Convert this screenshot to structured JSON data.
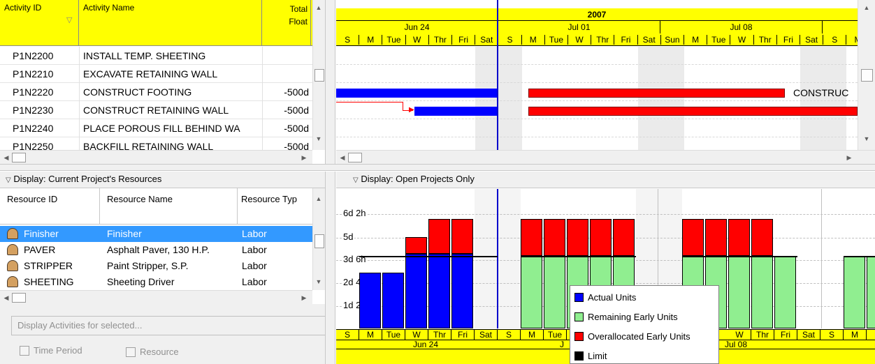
{
  "activity_table": {
    "headers": {
      "id": "Activity ID",
      "name": "Activity Name",
      "float_line1": "Total",
      "float_line2": "Float"
    },
    "rows": [
      {
        "id": "P1N2200",
        "name": "INSTALL TEMP. SHEETING",
        "float": ""
      },
      {
        "id": "P1N2210",
        "name": "EXCAVATE RETAINING WALL",
        "float": ""
      },
      {
        "id": "P1N2220",
        "name": "CONSTRUCT FOOTING",
        "float": "-500d"
      },
      {
        "id": "P1N2230",
        "name": "CONSTRUCT RETAINING WALL",
        "float": "-500d"
      },
      {
        "id": "P1N2240",
        "name": "PLACE POROUS FILL BEHIND WA",
        "float": "-500d"
      },
      {
        "id": "P1N2250",
        "name": "BACKFILL RETAINING WALL",
        "float": "-500d"
      }
    ]
  },
  "gantt": {
    "year": "2007",
    "weeks": [
      "Jun 24",
      "Jul 01",
      "Jul 08"
    ],
    "days": [
      "S",
      "M",
      "Tue",
      "W",
      "Thr",
      "Fri",
      "Sat",
      "S",
      "M",
      "Tue",
      "W",
      "Thr",
      "Fri",
      "Sat",
      "Sun",
      "M",
      "Tue",
      "W",
      "Thr",
      "Fri",
      "Sat",
      "S",
      "M"
    ],
    "bar_label": "CONSTRUC"
  },
  "resources_pane": {
    "title": "Display: Current Project's Resources",
    "headers": {
      "id": "Resource ID",
      "name": "Resource Name",
      "type": "Resource Typ"
    },
    "rows": [
      {
        "id": "Finisher",
        "name": "Finisher",
        "type": "Labor",
        "selected": true
      },
      {
        "id": "PAVER",
        "name": "Asphalt Paver, 130 H.P.",
        "type": "Labor",
        "selected": false
      },
      {
        "id": "STRIPPER",
        "name": "Paint Stripper, S.P.",
        "type": "Labor",
        "selected": false
      },
      {
        "id": "SHEETING",
        "name": "Sheeting Driver",
        "type": "Labor",
        "selected": false
      }
    ],
    "display_activities_label": "Display Activities for selected...",
    "time_period_label": "Time Period",
    "resource_label": "Resource"
  },
  "histogram": {
    "title": "Display: Open Projects Only",
    "y_labels": [
      "6d 2h",
      "5d",
      "3d 6h",
      "2d 4h",
      "1d 2h"
    ],
    "days": [
      "S",
      "M",
      "Tue",
      "W",
      "Thr",
      "Fri",
      "Sat",
      "S",
      "M",
      "Tue"
    ],
    "days_right": [
      "W",
      "Thr",
      "Fri",
      "Sat",
      "S",
      "M",
      "T"
    ],
    "week_left": "Jun 24",
    "week_mid": "J",
    "week_right": "Jul 08",
    "legend": [
      {
        "label": "Actual Units",
        "color": "#0000ff"
      },
      {
        "label": "Remaining Early Units",
        "color": "#90ee90"
      },
      {
        "label": "Overallocated Early Units",
        "color": "#ff0000"
      },
      {
        "label": "Limit",
        "color": "#000000"
      }
    ]
  },
  "colors": {
    "accent": "#ffff00",
    "selection": "#3399ff",
    "actual": "#0000ff",
    "remaining": "#90ee90",
    "overallocated": "#ff0000"
  }
}
